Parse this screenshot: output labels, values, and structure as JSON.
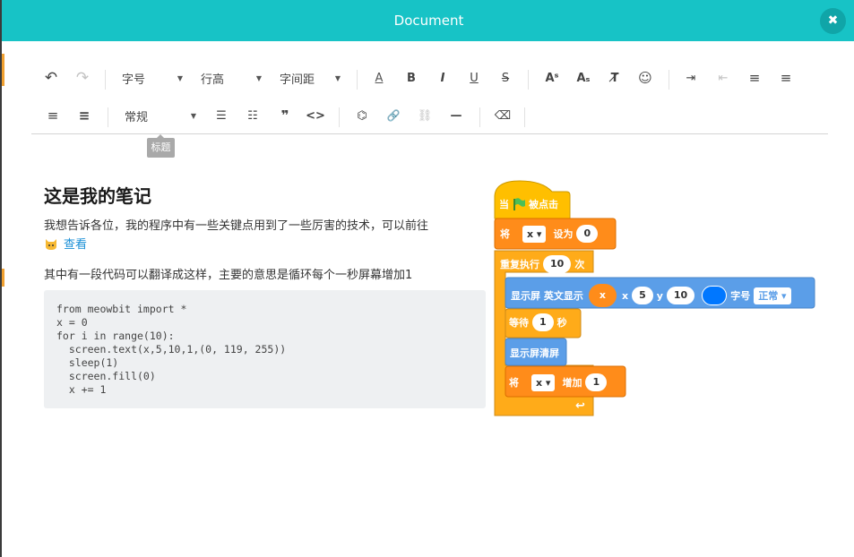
{
  "window": {
    "title": "Document",
    "close_glyph": "✖"
  },
  "toolbar": {
    "undo": "↶",
    "redo": "↷",
    "font_size": "字号",
    "line_height": "行高",
    "letter_spacing": "字间距",
    "font_color": "A",
    "bold": "B",
    "italic": "I",
    "underline": "U",
    "strike": "S",
    "superscript": "Aˢ",
    "subscript": "Aₛ",
    "clear_format": "T̸",
    "emoji": "☺",
    "indent": "⇥",
    "outdent": "⇤",
    "align_left": "≡",
    "align_justify": "≡",
    "align_right": "≡",
    "align_full": "≡",
    "heading_select": "常规",
    "bullet_list": "☰",
    "numbered_list": "☷",
    "quote": "❞",
    "code": "<>",
    "translate": "⌬",
    "link": "🔗",
    "unlink": "⛓",
    "hr": "—",
    "clear": "⌫",
    "tooltip": "标题"
  },
  "doc": {
    "title": "这是我的笔记",
    "p1": "我想告诉各位，我的程序中有一些关键点用到了一些厉害的技术，可以前往",
    "p1_link": "查看",
    "p2": "其中有一段代码可以翻译成这样，主要的意思是循环每个一秒屏幕增加1",
    "code": "from meowbit import *\nx = 0\nfor i in range(10):\n  screen.text(x,5,10,1,(0, 119, 255))\n  sleep(1)\n  screen.fill(0)\n  x += 1"
  },
  "blocks": {
    "hat": {
      "prefix": "当",
      "suffix": "被点击"
    },
    "set": {
      "label": "将",
      "var": "x ▾",
      "to": "设为",
      "value": "0"
    },
    "repeat": {
      "label": "重复执行",
      "count": "10",
      "unit": "次",
      "end_arrow": "↩"
    },
    "text": {
      "label": "显示屏 英文显示",
      "x_reporter": "x",
      "x": "x",
      "x_val": "5",
      "y": "y",
      "y_val": "10",
      "size": "字号",
      "size_val": "正常 ▾"
    },
    "wait": {
      "label": "等待",
      "value": "1",
      "unit": "秒"
    },
    "clear": {
      "label": "显示屏清屏"
    },
    "change": {
      "label": "将",
      "var": "x ▾",
      "by": "增加",
      "value": "1"
    },
    "colors": {
      "event": "#ffbf00",
      "control": "#ffab19",
      "variables": "#ff8c1a",
      "screen": "#5b9ee8",
      "color_swatch": "#0077ff"
    }
  }
}
